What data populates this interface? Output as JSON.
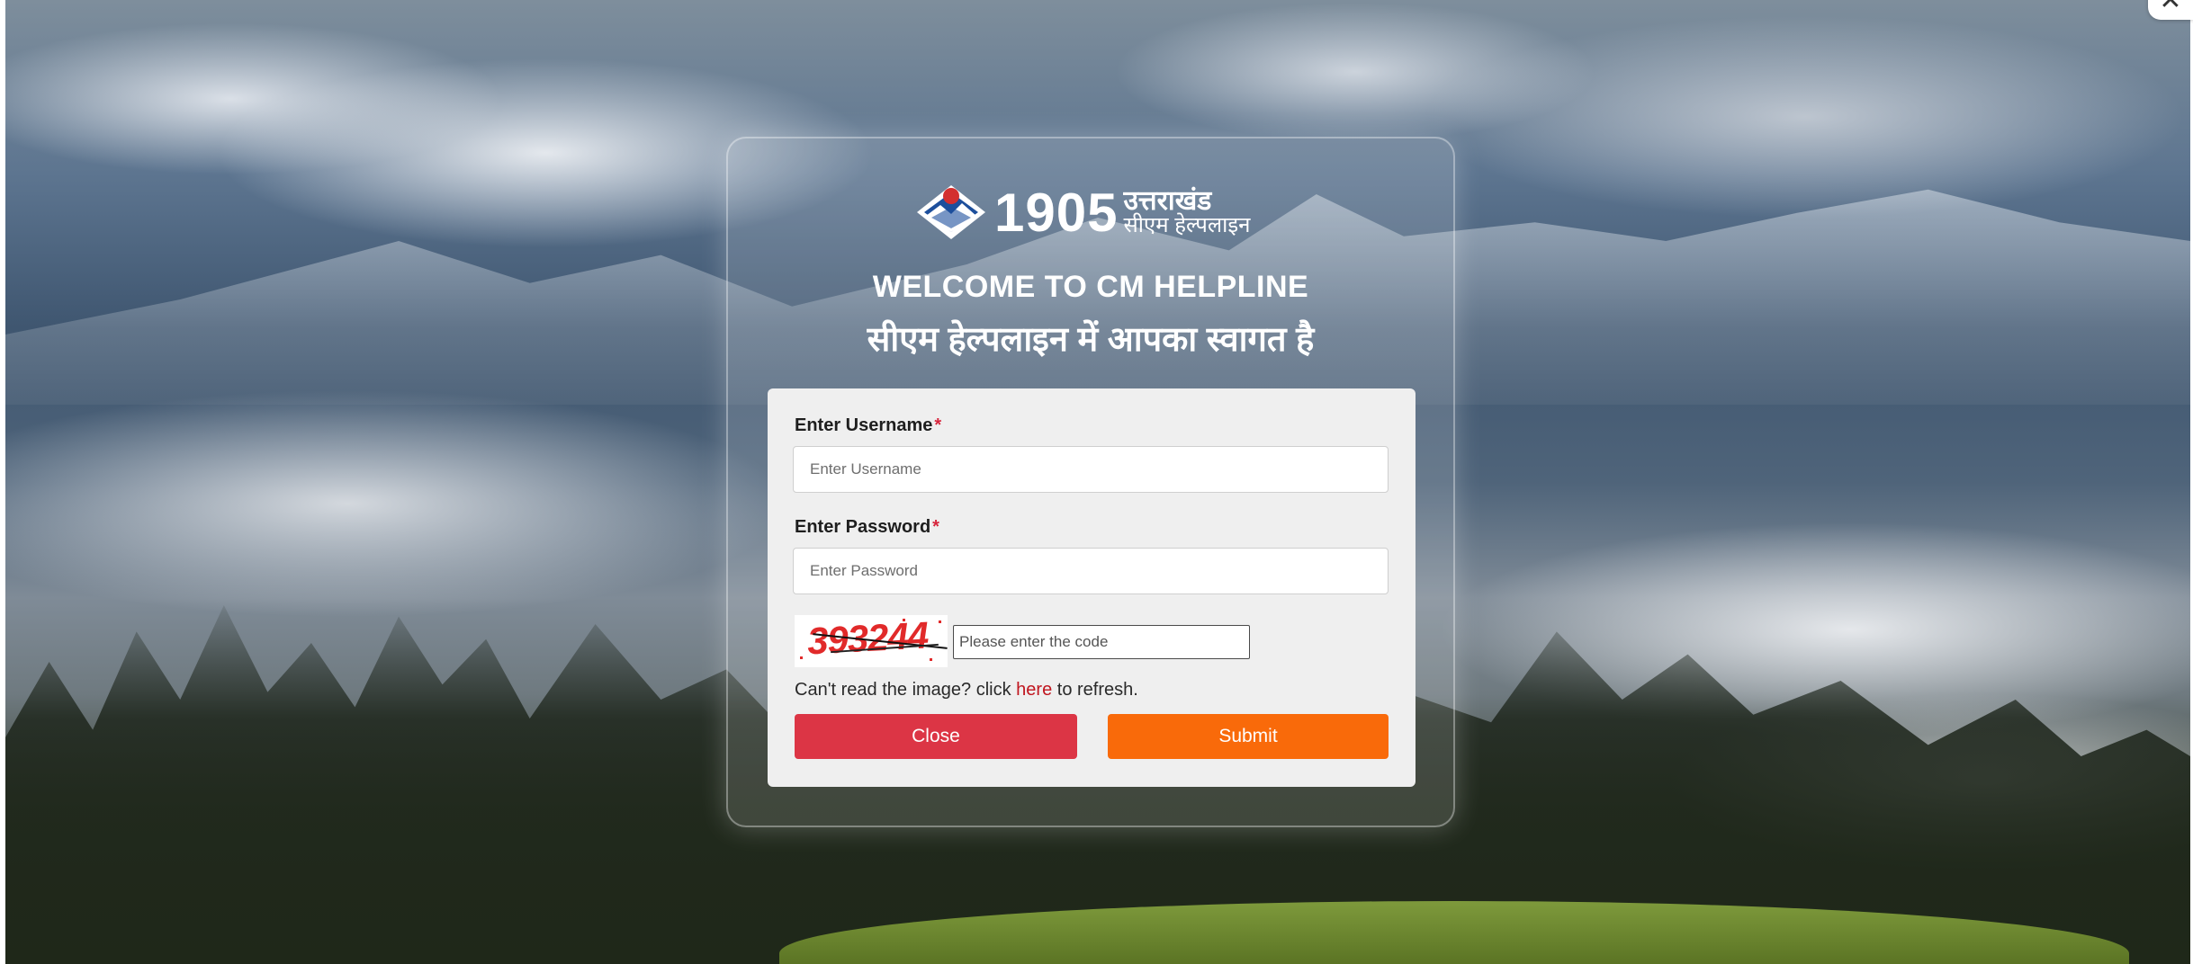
{
  "logo": {
    "number": "1905",
    "hindi_line1": "उत्तराखंड",
    "hindi_line2": "सीएम हेल्पलाइन"
  },
  "welcome": {
    "english": "WELCOME TO CM HELPLINE",
    "hindi": "सीएम हेल्पलाइन में आपका स्वागत है"
  },
  "form": {
    "username_label": "Enter Username",
    "username_placeholder": "Enter Username",
    "password_label": "Enter Password",
    "password_placeholder": "Enter Password",
    "required_mark": "*",
    "captcha_code": "393244",
    "captcha_placeholder": "Please enter the code",
    "refresh_prefix": "Can't read the image? click",
    "refresh_link": "here",
    "refresh_suffix": "to refresh.",
    "close_label": "Close",
    "submit_label": "Submit"
  },
  "window": {
    "close_glyph": "✕"
  },
  "colors": {
    "close_button": "#dc3545",
    "submit_button": "#f96a0a",
    "required": "#d7263d",
    "link": "#c0161f"
  },
  "icons": [
    "close-icon",
    "uttarakhand-emblem-icon"
  ]
}
